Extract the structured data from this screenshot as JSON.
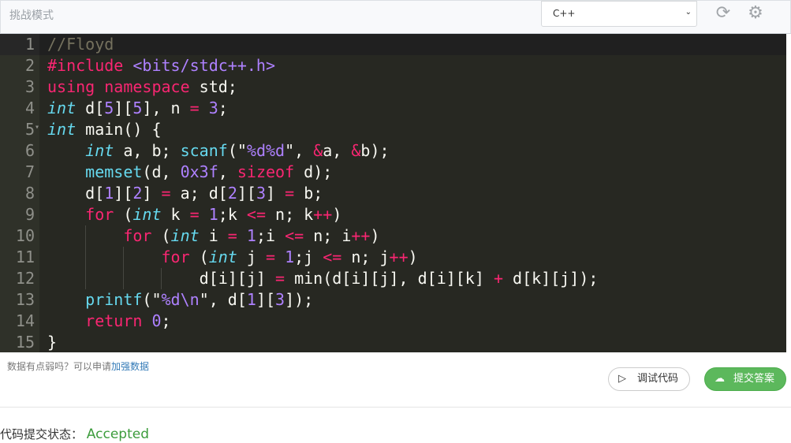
{
  "header": {
    "title": "挑战模式",
    "language": "C++",
    "refresh_icon": "refresh-icon",
    "settings_icon": "gear-icon"
  },
  "editor": {
    "lines": [
      [
        [
          "c-comment",
          "//Floyd"
        ]
      ],
      [
        [
          "c-kw",
          "#include"
        ],
        [
          "c-def",
          " "
        ],
        [
          "c-str",
          "<bits/stdc++.h>"
        ]
      ],
      [
        [
          "c-kw",
          "using"
        ],
        [
          "c-def",
          " "
        ],
        [
          "c-kw",
          "namespace"
        ],
        [
          "c-def",
          " std;"
        ]
      ],
      [
        [
          "c-type",
          "int"
        ],
        [
          "c-def",
          " d["
        ],
        [
          "c-num",
          "5"
        ],
        [
          "c-def",
          "]["
        ],
        [
          "c-num",
          "5"
        ],
        [
          "c-def",
          "], n "
        ],
        [
          "c-op",
          "="
        ],
        [
          "c-def",
          " "
        ],
        [
          "c-num",
          "3"
        ],
        [
          "c-def",
          ";"
        ]
      ],
      [
        [
          "c-type",
          "int"
        ],
        [
          "c-def",
          " main() {"
        ]
      ],
      [
        [
          "c-def",
          "    "
        ],
        [
          "c-type",
          "int"
        ],
        [
          "c-def",
          " a, b; "
        ],
        [
          "c-fn",
          "scanf"
        ],
        [
          "c-def",
          "(\""
        ],
        [
          "c-str",
          "%d%d"
        ],
        [
          "c-def",
          "\", "
        ],
        [
          "c-op",
          "&"
        ],
        [
          "c-def",
          "a, "
        ],
        [
          "c-op",
          "&"
        ],
        [
          "c-def",
          "b);"
        ]
      ],
      [
        [
          "c-def",
          "    "
        ],
        [
          "c-fn",
          "memset"
        ],
        [
          "c-def",
          "(d, "
        ],
        [
          "c-num",
          "0x3f"
        ],
        [
          "c-def",
          ", "
        ],
        [
          "c-kw",
          "sizeof"
        ],
        [
          "c-def",
          " d);"
        ]
      ],
      [
        [
          "c-def",
          "    d["
        ],
        [
          "c-num",
          "1"
        ],
        [
          "c-def",
          "]["
        ],
        [
          "c-num",
          "2"
        ],
        [
          "c-def",
          "] "
        ],
        [
          "c-op",
          "="
        ],
        [
          "c-def",
          " a; d["
        ],
        [
          "c-num",
          "2"
        ],
        [
          "c-def",
          "]["
        ],
        [
          "c-num",
          "3"
        ],
        [
          "c-def",
          "] "
        ],
        [
          "c-op",
          "="
        ],
        [
          "c-def",
          " b;"
        ]
      ],
      [
        [
          "c-def",
          "    "
        ],
        [
          "c-kw",
          "for"
        ],
        [
          "c-def",
          " ("
        ],
        [
          "c-type",
          "int"
        ],
        [
          "c-def",
          " k "
        ],
        [
          "c-op",
          "="
        ],
        [
          "c-def",
          " "
        ],
        [
          "c-num",
          "1"
        ],
        [
          "c-def",
          ";k "
        ],
        [
          "c-op",
          "<="
        ],
        [
          "c-def",
          " n; k"
        ],
        [
          "c-op",
          "++"
        ],
        [
          "c-def",
          ")"
        ]
      ],
      [
        [
          "c-def",
          "        "
        ],
        [
          "c-kw",
          "for"
        ],
        [
          "c-def",
          " ("
        ],
        [
          "c-type",
          "int"
        ],
        [
          "c-def",
          " i "
        ],
        [
          "c-op",
          "="
        ],
        [
          "c-def",
          " "
        ],
        [
          "c-num",
          "1"
        ],
        [
          "c-def",
          ";i "
        ],
        [
          "c-op",
          "<="
        ],
        [
          "c-def",
          " n; i"
        ],
        [
          "c-op",
          "++"
        ],
        [
          "c-def",
          ")"
        ]
      ],
      [
        [
          "c-def",
          "            "
        ],
        [
          "c-kw",
          "for"
        ],
        [
          "c-def",
          " ("
        ],
        [
          "c-type",
          "int"
        ],
        [
          "c-def",
          " j "
        ],
        [
          "c-op",
          "="
        ],
        [
          "c-def",
          " "
        ],
        [
          "c-num",
          "1"
        ],
        [
          "c-def",
          ";j "
        ],
        [
          "c-op",
          "<="
        ],
        [
          "c-def",
          " n; j"
        ],
        [
          "c-op",
          "++"
        ],
        [
          "c-def",
          ")"
        ]
      ],
      [
        [
          "c-def",
          "                d[i][j] "
        ],
        [
          "c-op",
          "="
        ],
        [
          "c-def",
          " min(d[i][j], d[i][k] "
        ],
        [
          "c-op",
          "+"
        ],
        [
          "c-def",
          " d[k][j]);"
        ]
      ],
      [
        [
          "c-def",
          "    "
        ],
        [
          "c-fn",
          "printf"
        ],
        [
          "c-def",
          "(\""
        ],
        [
          "c-str",
          "%d\\n"
        ],
        [
          "c-def",
          "\", d["
        ],
        [
          "c-num",
          "1"
        ],
        [
          "c-def",
          "]["
        ],
        [
          "c-num",
          "3"
        ],
        [
          "c-def",
          "]);"
        ]
      ],
      [
        [
          "c-def",
          "    "
        ],
        [
          "c-kw",
          "return"
        ],
        [
          "c-def",
          " "
        ],
        [
          "c-num",
          "0"
        ],
        [
          "c-def",
          ";"
        ]
      ],
      [
        [
          "c-def",
          "}"
        ]
      ]
    ]
  },
  "footer": {
    "hint_text": "数据有点弱吗？可以申请",
    "hint_link": "加强数据",
    "debug_label": "调试代码",
    "submit_label": "提交答案",
    "status_label": "代码提交状态：",
    "status_value": "Accepted",
    "status_color": "#3c9c3c",
    "submit_color": "#5cb85c"
  }
}
